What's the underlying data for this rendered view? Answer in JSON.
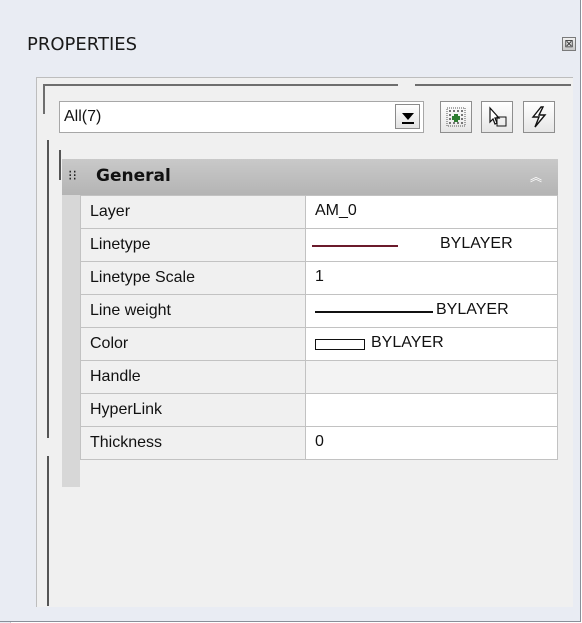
{
  "palette": {
    "title": "PROPERTIES",
    "close_glyph": "⊠"
  },
  "selector": {
    "value": "All(7)",
    "dropdown_icon": "dropdown-arrow-icon"
  },
  "toolbar": {
    "buttons": [
      {
        "name": "toggle-pickadd-button",
        "icon": "pickadd-grid-icon"
      },
      {
        "name": "select-objects-button",
        "icon": "select-cursor-icon"
      },
      {
        "name": "quick-select-button",
        "icon": "quick-select-lightning-icon"
      }
    ]
  },
  "section": {
    "title": "General",
    "grip_icon": "grip-icon",
    "collapse_glyph": "«"
  },
  "properties": [
    {
      "label": "Layer",
      "value": "AM_0"
    },
    {
      "label": "Linetype",
      "value": "BYLAYER",
      "line_color": "#6b1a2b"
    },
    {
      "label": "Linetype Scale",
      "value": "1"
    },
    {
      "label": "Line weight",
      "value": "BYLAYER"
    },
    {
      "label": "Color",
      "value": "BYLAYER"
    },
    {
      "label": "Handle",
      "value": ""
    },
    {
      "label": "HyperLink",
      "value": ""
    },
    {
      "label": "Thickness",
      "value": "0"
    }
  ]
}
